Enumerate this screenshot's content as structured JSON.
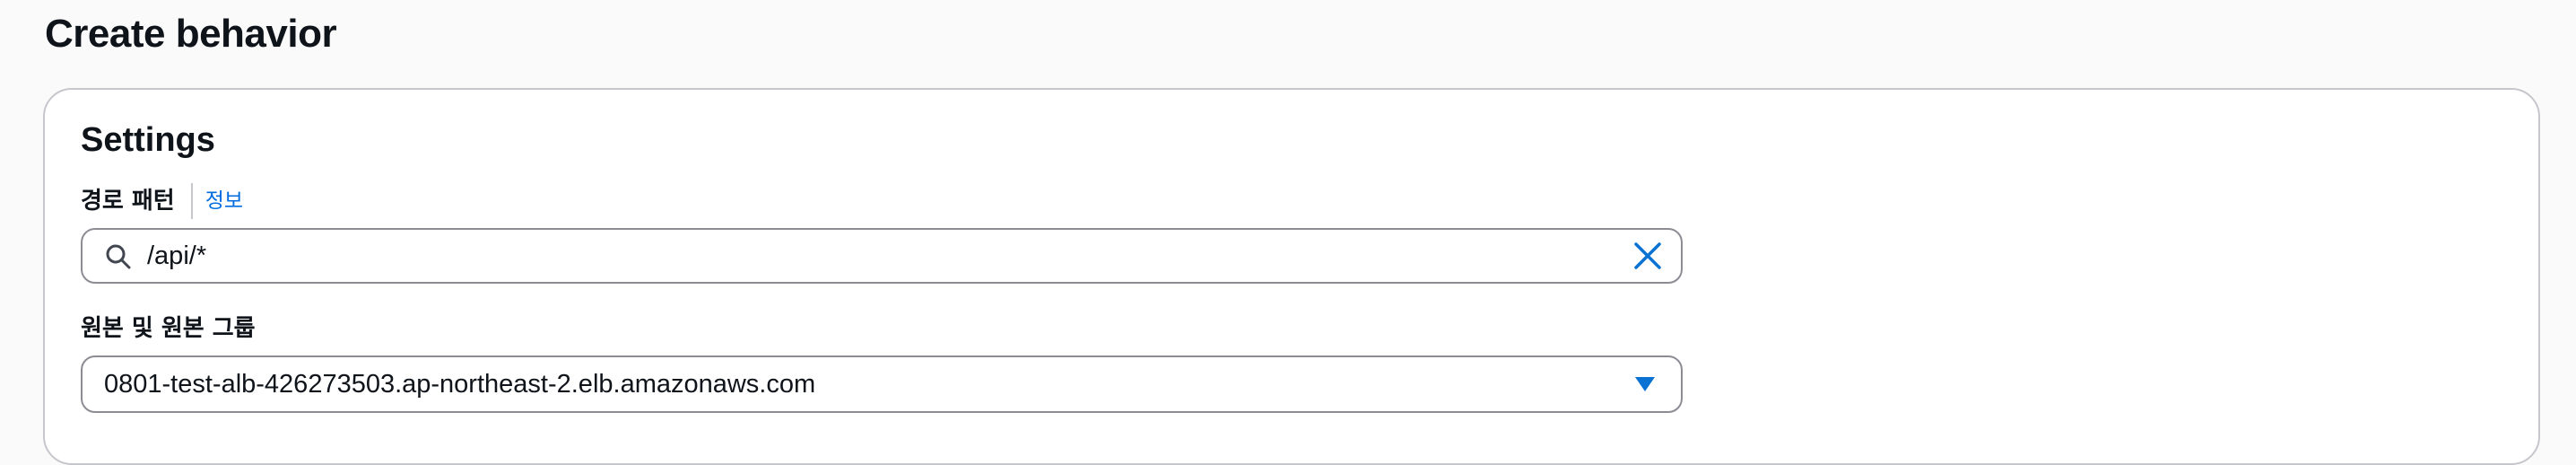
{
  "page": {
    "title": "Create behavior"
  },
  "settings": {
    "title": "Settings",
    "path_pattern": {
      "label": "경로 패턴",
      "info_link": "정보",
      "value": "/api/*"
    },
    "origin": {
      "label": "원본 및 원본 그룹",
      "selected_value": "0801-test-alb-426273503.ap-northeast-2.elb.amazonaws.com"
    }
  },
  "icons": {
    "search": "search-icon",
    "clear": "close-icon",
    "dropdown": "caret-down-icon"
  },
  "colors": {
    "link": "#006ce0",
    "icon_blue": "#0972d3",
    "border": "#8c8c94",
    "text": "#0f141a"
  }
}
